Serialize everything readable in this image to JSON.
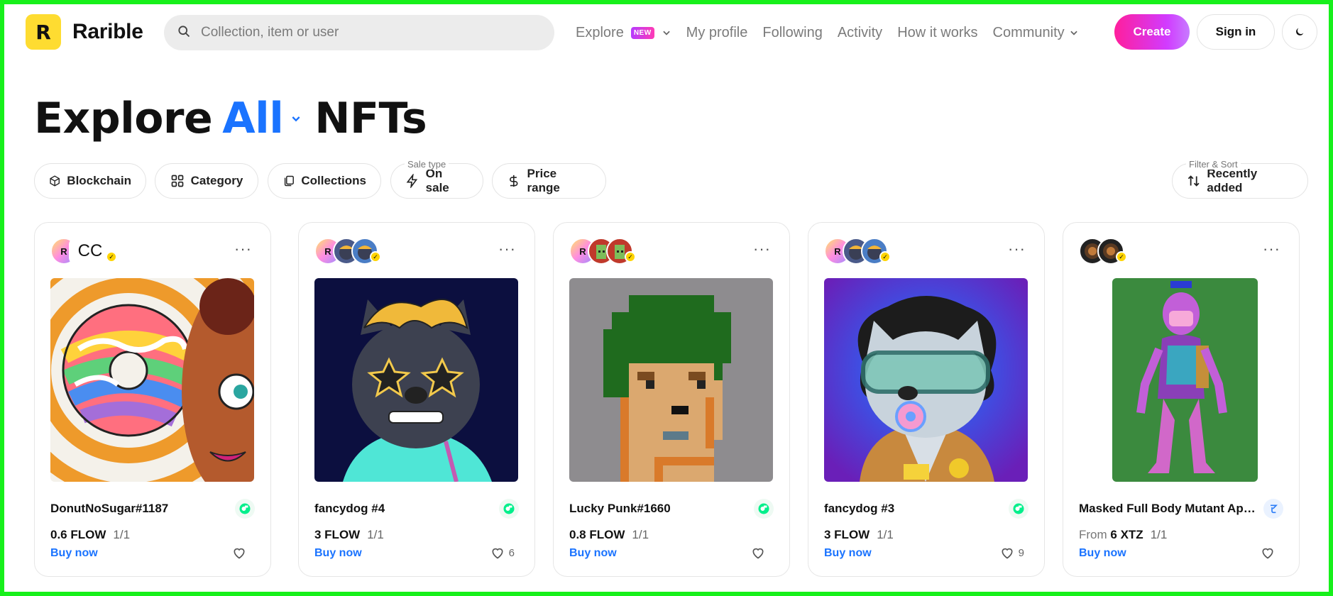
{
  "brand": {
    "name": "Rarible",
    "mark": "R"
  },
  "search": {
    "placeholder": "Collection, item or user"
  },
  "nav": {
    "explore": "Explore",
    "explore_badge": "NEW",
    "my_profile": "My profile",
    "following": "Following",
    "activity": "Activity",
    "how_it_works": "How it works",
    "community": "Community"
  },
  "actions": {
    "create": "Create",
    "sign_in": "Sign in"
  },
  "title": {
    "prefix": "Explore",
    "selected": "All",
    "suffix": "NFTs"
  },
  "filters": {
    "blockchain": "Blockchain",
    "category": "Category",
    "collections": "Collections",
    "sale_type_label": "Sale type",
    "sale_type_value": "On sale",
    "price_range": "Price range",
    "sort_label": "Filter & Sort",
    "sort_value": "Recently added"
  },
  "accent_colors": {
    "brand_yellow": "#fedc31",
    "link_blue": "#1a73ff",
    "flow_green": "#00ef8b",
    "tezos_blue": "#2c7df7"
  },
  "cards": [
    {
      "name": "DonutNoSugar#1187",
      "price_prefix": "",
      "price": "0.6 FLOW",
      "edition": "1/1",
      "buy": "Buy now",
      "likes": "",
      "chain_icon": "flow-icon"
    },
    {
      "name": "fancydog #4",
      "price_prefix": "",
      "price": "3 FLOW",
      "edition": "1/1",
      "buy": "Buy now",
      "likes": "6",
      "chain_icon": "flow-icon"
    },
    {
      "name": "Lucky Punk#1660",
      "price_prefix": "",
      "price": "0.8 FLOW",
      "edition": "1/1",
      "buy": "Buy now",
      "likes": "",
      "chain_icon": "flow-icon"
    },
    {
      "name": "fancydog #3",
      "price_prefix": "",
      "price": "3 FLOW",
      "edition": "1/1",
      "buy": "Buy now",
      "likes": "9",
      "chain_icon": "flow-icon"
    },
    {
      "name": "Masked Full Body Mutant Ape ...",
      "price_prefix": "From",
      "price": "6 XTZ",
      "edition": "1/1",
      "buy": "Buy now",
      "likes": "",
      "chain_icon": "tezos-icon"
    }
  ]
}
